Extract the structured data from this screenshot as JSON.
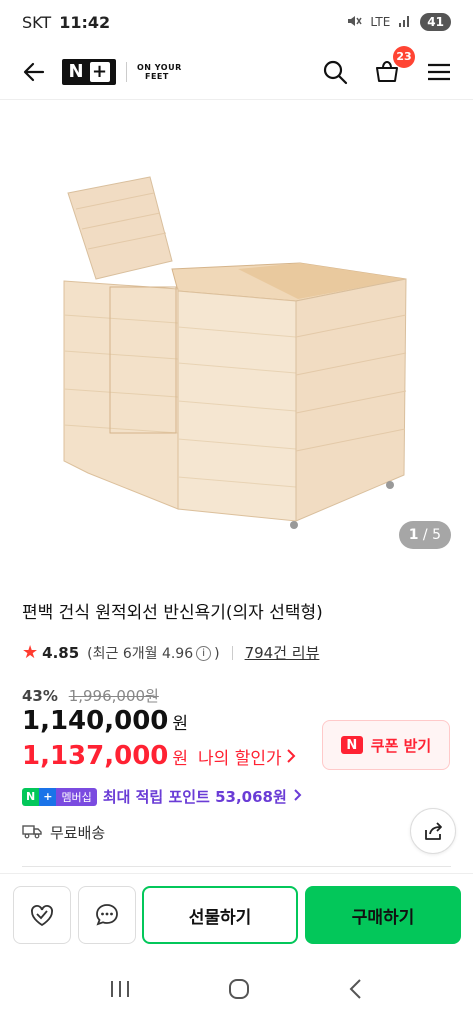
{
  "status": {
    "carrier": "SKT",
    "time": "11:42",
    "network": "LTE",
    "battery": "41"
  },
  "header": {
    "brand_logo_line1": "ON YOUR",
    "brand_logo_line2": "FEET",
    "cart_count": "23"
  },
  "gallery": {
    "current": "1",
    "total": "/ 5"
  },
  "product": {
    "title": "편백 건식 원적외선 반신욕기(의자 선택형)",
    "rating": "4.85",
    "recent_rating_prefix": "(최근 6개월 4.96",
    "recent_rating_suffix": ")",
    "reviews": "794건 리뷰",
    "discount_pct": "43%",
    "original_price": "1,996,000원",
    "price": "1,140,000",
    "won": "원",
    "my_price": "1,137,000",
    "my_price_label": "나의 할인가",
    "points_text": "최대 적립 포인트 53,068원",
    "shipping": "무료배송"
  },
  "coupon": {
    "badge": "N",
    "label": "쿠폰 받기"
  },
  "membership": {
    "n": "N",
    "plus": "+",
    "member": "멤버십"
  },
  "actions": {
    "gift": "선물하기",
    "buy": "구매하기"
  },
  "colors": {
    "accent_green": "#03c75a",
    "sale_red": "#ff2233",
    "points_purple": "#6a3cd6"
  },
  "icons": [
    "back-arrow-icon",
    "search-icon",
    "cart-icon",
    "menu-icon",
    "star-icon",
    "info-icon",
    "truck-icon",
    "share-icon",
    "heart-check-icon",
    "chat-icon"
  ]
}
